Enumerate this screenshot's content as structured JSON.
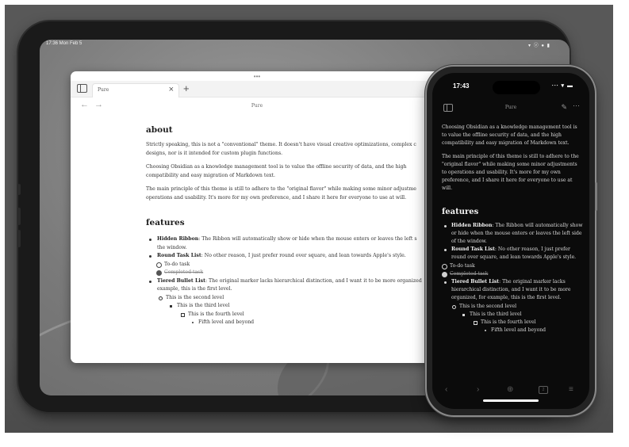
{
  "ipad": {
    "status_time": "17:36  Mon Feb 5",
    "status_icons": "▾ ⓥ ● ▮",
    "window_dots": "•••",
    "tab_label": "Pure",
    "tab_close": "×",
    "new_tab": "+",
    "nav_back": "←",
    "nav_forward": "→",
    "note_title": "Pure"
  },
  "note": {
    "about_heading": "about",
    "about_p1": "Strictly speaking, this is not a \"conventional\" theme. It doesn't have visual creative optimizations, complex c",
    "about_p1b": "designs, nor is it intended for custom plugin functions.",
    "about_p2": "Choosing Obsidian as a knowledge management tool is to value the offline security of data, and the high",
    "about_p2b": "compatibility and easy migration of Markdown text.",
    "about_p3": "The main principle of this theme is still to adhere to the \"original flavor\" while making some minor adjustme",
    "about_p3b": "operations and usability. It's more for my own preference, and I share it here for everyone to use at will.",
    "features_heading": "features",
    "f1_title": "Hidden Ribbon",
    "f1_text": ": The Ribbon will automatically show or hide when the mouse enters or leaves the left s",
    "f1_text2": "the window.",
    "f2_title": "Round Task List",
    "f2_text": ": No other reason, I just prefer round over square, and lean towards Apple's style.",
    "task_todo": "To-do task",
    "task_done": "Completed task",
    "f3_title": "Tiered Bullet List",
    "f3_text": ": The original marker lacks hierarchical distinction, and I want it to be more organized",
    "f3_text2": "example, this is the first level.",
    "level2": "This is the second level",
    "level3": "This is the third level",
    "level4": "This is the fourth level",
    "level5": "Fifth level and beyond"
  },
  "phone": {
    "time": "17:43",
    "status_icons": "∙∙∙ ▾ ▬",
    "title": "Pure",
    "edit_icon": "✎",
    "more_icon": "⋯",
    "p1": "Choosing Obsidian as a knowledge management tool is to value the offline security of data, and the high compatibility and easy migration of Markdown text.",
    "p2": "The main principle of this theme is still to adhere to the \"original flavor\" while making some minor adjustments to operations and usability. It's more for my own preference, and I share it here for everyone to use at will.",
    "features_heading": "features",
    "f1_title": "Hidden Ribbon",
    "f1_text": ": The Ribbon will automatically show or hide when the mouse enters or leaves the left side of the window.",
    "f2_title": "Round Task List",
    "f2_text": ": No other reason, I just prefer round over square, and lean towards Apple's style.",
    "task_todo": "To-do task",
    "task_done": "Completed task",
    "f3_title": "Tiered Bullet List",
    "f3_text": ": The original marker lacks hierarchical distinction, and I want it to be more organized, for example, this is the first level.",
    "level2": "This is the second level",
    "level3": "This is the third level",
    "level4": "This is the fourth level",
    "level5": "Fifth level and beyond",
    "nav_back": "‹",
    "nav_forward": "›",
    "new_note": "⊕",
    "tab_count": "2",
    "menu": "≡"
  },
  "colors": {
    "backdrop": "#585858",
    "window_bg": "#ffffff",
    "phone_bg": "#0b0b0b"
  }
}
